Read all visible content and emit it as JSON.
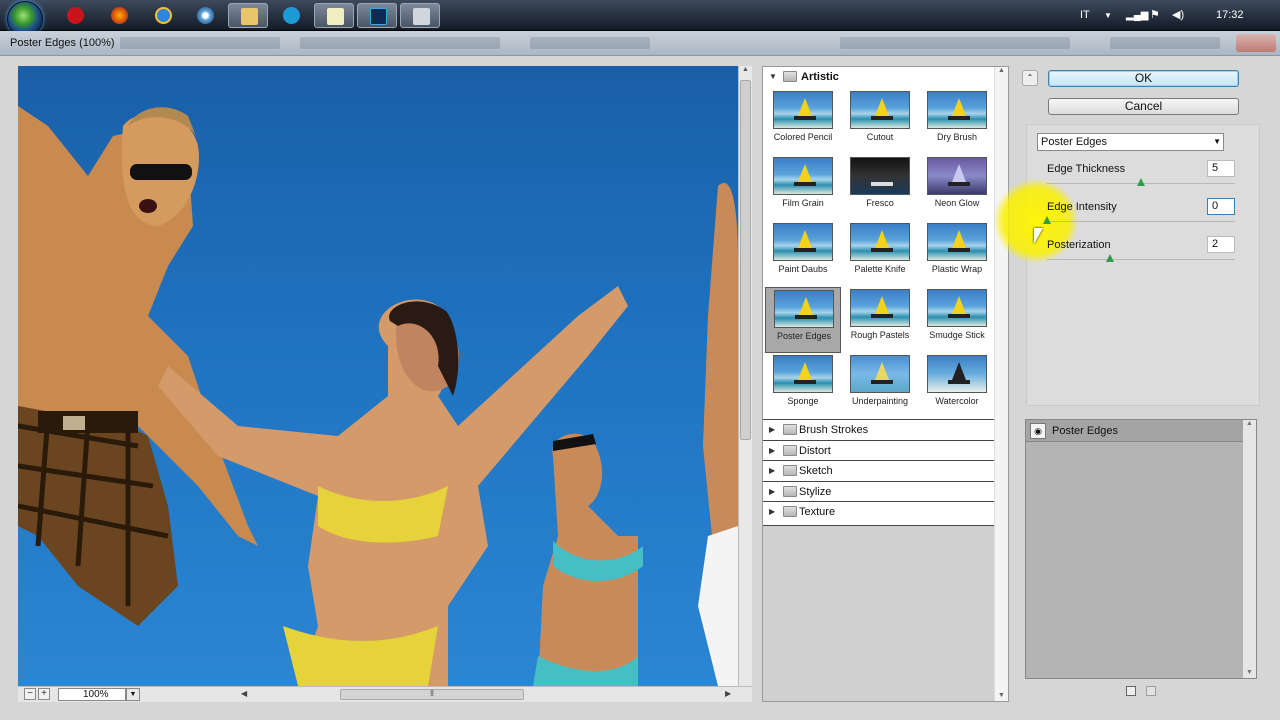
{
  "taskbar": {
    "icons": [
      "start-orb",
      "opera-icon",
      "firefox-icon",
      "internet-explorer-icon",
      "circle-app-icon",
      "explorer-folder-icon",
      "skype-icon",
      "notepad-icon",
      "photoshop-icon",
      "tools-icon"
    ],
    "tray": {
      "language": "IT",
      "time": "17:32"
    }
  },
  "window": {
    "title": "Poster Edges (100%)"
  },
  "preview": {
    "zoom": "100%"
  },
  "gallery": {
    "category_open": "Artistic",
    "filters": [
      "Colored Pencil",
      "Cutout",
      "Dry Brush",
      "Film Grain",
      "Fresco",
      "Neon Glow",
      "Paint Daubs",
      "Palette Knife",
      "Plastic Wrap",
      "Poster Edges",
      "Rough Pastels",
      "Smudge Stick",
      "Sponge",
      "Underpainting",
      "Watercolor"
    ],
    "selected_filter": "Poster Edges",
    "categories": [
      "Brush Strokes",
      "Distort",
      "Sketch",
      "Stylize",
      "Texture"
    ]
  },
  "buttons": {
    "ok": "OK",
    "cancel": "Cancel"
  },
  "settings": {
    "filter_select": "Poster Edges",
    "params": [
      {
        "label": "Edge Thickness",
        "value": "5",
        "level": 0.5
      },
      {
        "label": "Edge Intensity",
        "value": "0",
        "level": 0.0
      },
      {
        "label": "Posterization",
        "value": "2",
        "level": 0.333
      }
    ]
  },
  "layers": {
    "items": [
      "Poster Edges"
    ]
  },
  "colors": {
    "ok_border": "#3c7fb1",
    "slider_knob": "#2f9d4a",
    "highlight": "#fff500",
    "sky": "#1f73c0"
  }
}
